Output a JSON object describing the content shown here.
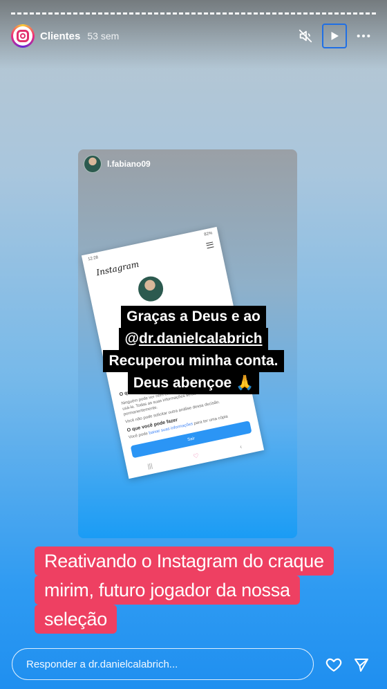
{
  "story": {
    "owner": "Clientes",
    "time_ago": "53 sem",
    "reply_placeholder": "Responder a dr.danielcalabrich..."
  },
  "icons": {
    "profile": "instagram-logo-icon",
    "mute": "speaker-muted-icon",
    "play": "play-icon",
    "more": "more-horizontal-icon",
    "like": "heart-icon",
    "share": "send-icon"
  },
  "repost": {
    "username": "l.fabiano09",
    "phone": {
      "status_time": "12:28",
      "status_right": "82%",
      "app_name": "Instagram",
      "behind_text": "conta",
      "section1_title": "O que isso significa",
      "section1_body": "Ninguém pode ver nem encontrar sua conta e você não pode usá-la. Todas as suas informações serão excluídas permanentemente.",
      "section1_note": "Você não pode solicitar outra análise dessa decisão.",
      "section2_title": "O que você pode fazer",
      "section2_body_prefix": "Você pode",
      "section2_link": "baixar suas informações",
      "section2_body_suffix": "para ter uma cópia",
      "button_label": "Sair"
    },
    "sticker_lines": [
      "Graças a Deus e ao",
      "dr.danielcalabrich",
      "Recuperou minha conta.",
      "Deus abençoe 🙏"
    ]
  },
  "caption_lines": [
    "Reativando o Instagram do craque",
    "mirim, futuro jogador da nossa",
    "seleção"
  ],
  "colors": {
    "caption_bg": "#ee4062",
    "play_focus": "#1f6fe5"
  }
}
